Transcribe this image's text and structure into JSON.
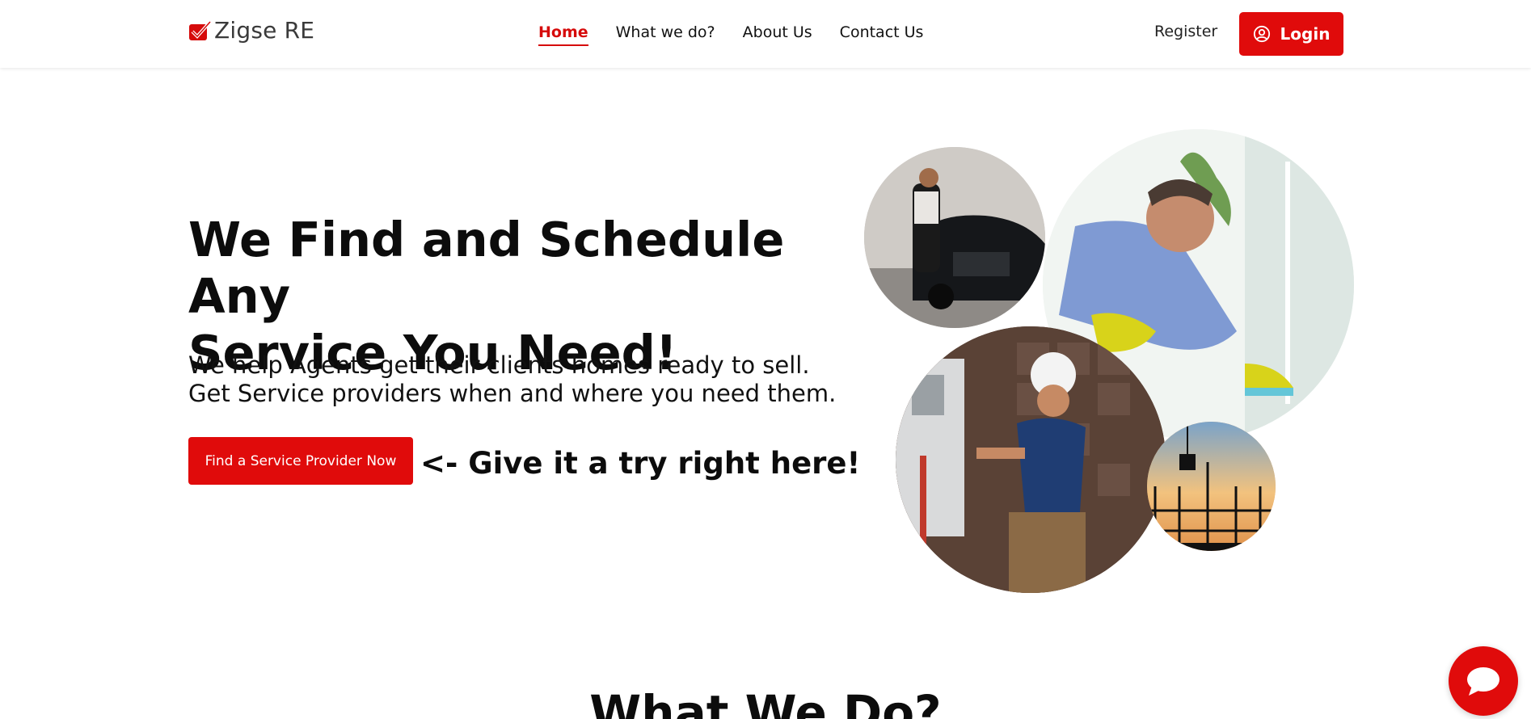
{
  "header": {
    "logo_text": "Zigse RE",
    "nav": [
      {
        "label": "Home",
        "active": true
      },
      {
        "label": "What we do?",
        "active": false
      },
      {
        "label": "About Us",
        "active": false
      },
      {
        "label": "Contact Us",
        "active": false
      }
    ],
    "register_label": "Register",
    "login_label": "Login"
  },
  "hero": {
    "title_line1": "We Find and Schedule Any",
    "title_line2": "Service You Need!",
    "sub_line1": "We help Agents get their clients homes ready to sell.",
    "sub_line2": "Get Service providers when and where you need them.",
    "cta_label": "Find a Service Provider Now",
    "try_text": "<- Give it a try right here!"
  },
  "section": {
    "title": "What We Do?"
  },
  "colors": {
    "brand": "#e00b0b",
    "text": "#0c0c0c"
  }
}
